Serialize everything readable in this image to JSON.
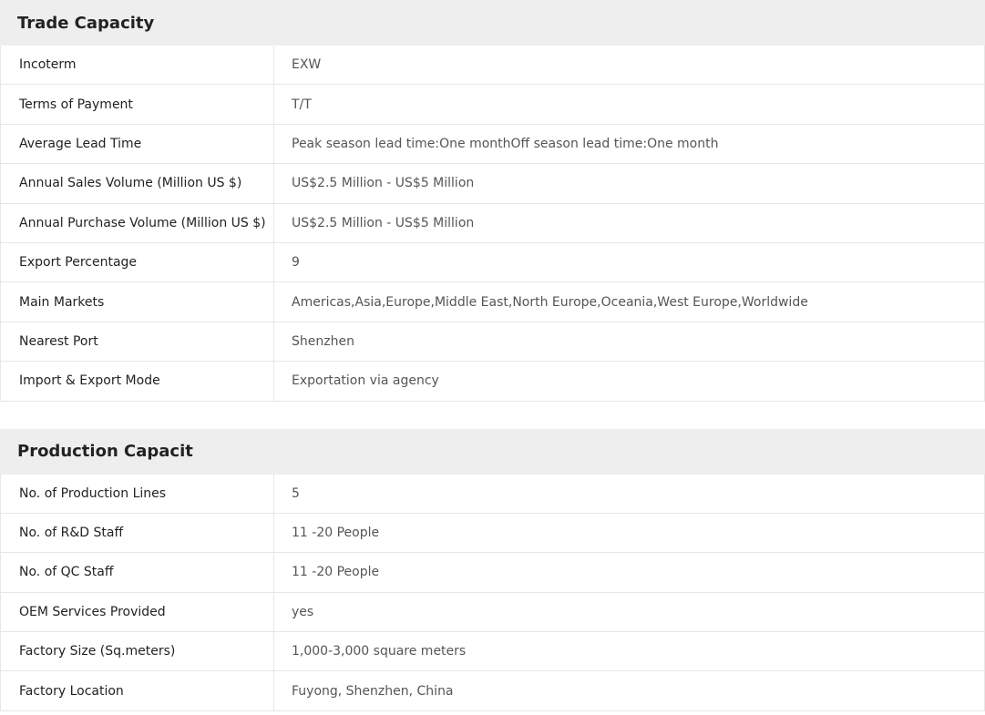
{
  "trade": {
    "title": "Trade Capacity",
    "rows": [
      {
        "label": "Incoterm",
        "value": "EXW"
      },
      {
        "label": "Terms of Payment",
        "value": "T/T"
      },
      {
        "label": "Average Lead Time",
        "value": "Peak season lead time:One monthOff season lead time:One month"
      },
      {
        "label": "Annual Sales Volume (Million US $)",
        "value": "US$2.5 Million - US$5 Million"
      },
      {
        "label": "Annual Purchase Volume (Million US $)",
        "value": "US$2.5 Million - US$5 Million"
      },
      {
        "label": "Export Percentage",
        "value": "9"
      },
      {
        "label": "Main Markets",
        "value": "Americas,Asia,Europe,Middle East,North Europe,Oceania,West Europe,Worldwide"
      },
      {
        "label": "Nearest Port",
        "value": "Shenzhen"
      },
      {
        "label": "Import & Export Mode",
        "value": "Exportation via agency"
      }
    ]
  },
  "production": {
    "title": "Production Capacit",
    "rows": [
      {
        "label": "No. of Production Lines",
        "value": "5"
      },
      {
        "label": "No. of R&D Staff",
        "value": "11 -20 People"
      },
      {
        "label": "No. of QC Staff",
        "value": "11 -20 People"
      },
      {
        "label": "OEM Services Provided",
        "value": "yes"
      },
      {
        "label": "Factory Size (Sq.meters)",
        "value": "1,000-3,000 square meters"
      },
      {
        "label": "Factory Location",
        "value": "Fuyong, Shenzhen, China"
      }
    ]
  }
}
